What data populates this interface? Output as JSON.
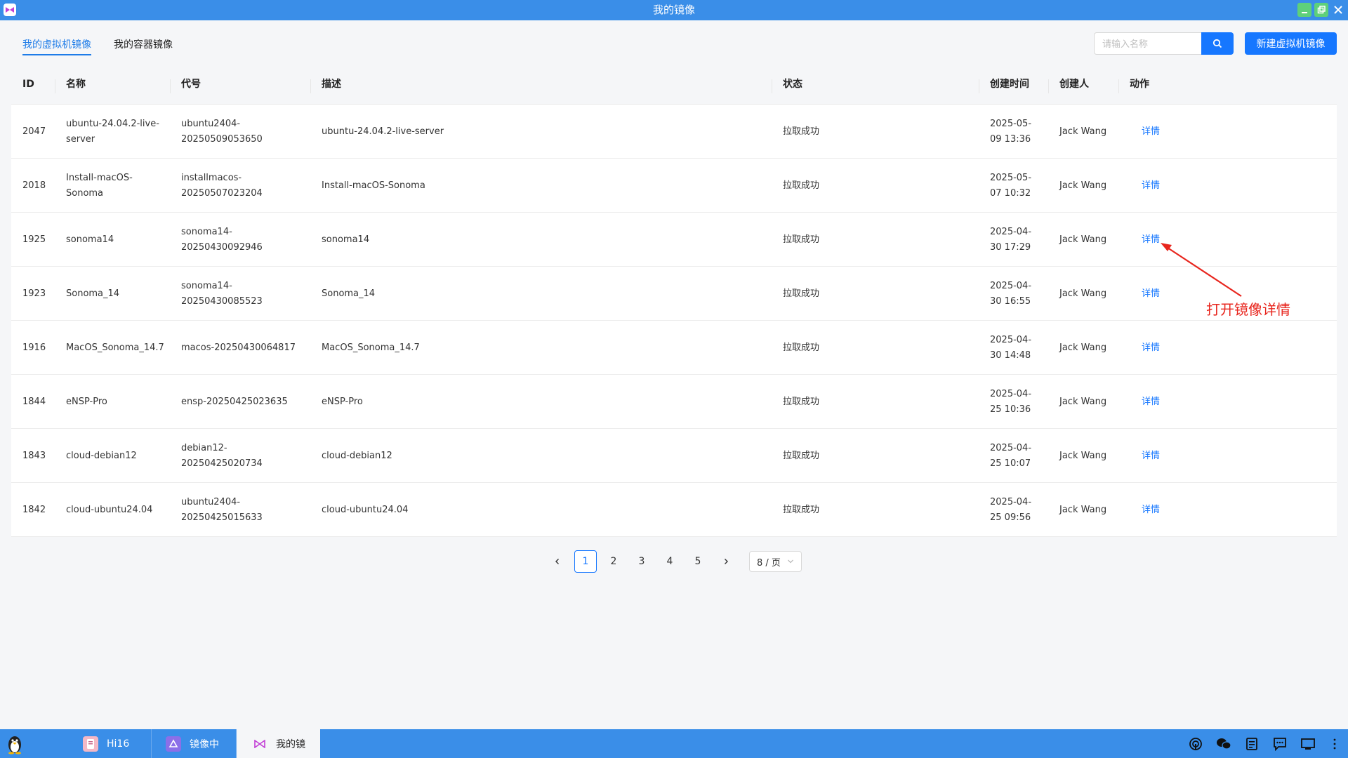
{
  "window": {
    "title": "我的镜像"
  },
  "tabs": [
    {
      "label": "我的虚拟机镜像",
      "active": true
    },
    {
      "label": "我的容器镜像",
      "active": false
    }
  ],
  "search": {
    "placeholder": "请输入名称",
    "value": ""
  },
  "new_button_label": "新建虚拟机镜像",
  "table": {
    "headers": [
      "ID",
      "名称",
      "代号",
      "描述",
      "状态",
      "创建时间",
      "创建人",
      "动作"
    ],
    "rows": [
      {
        "id": "2047",
        "name_lines": [
          "ubuntu-24.04.2-live-",
          "server"
        ],
        "code_lines": [
          "ubuntu2404-",
          "20250509053650"
        ],
        "desc": "ubuntu-24.04.2-live-server",
        "status": "拉取成功",
        "time_lines": [
          "2025-05-",
          "09 13:36"
        ],
        "creator": "Jack Wang",
        "action": "详情"
      },
      {
        "id": "2018",
        "name_lines": [
          "Install-macOS-",
          "Sonoma"
        ],
        "code_lines": [
          "installmacos-",
          "20250507023204"
        ],
        "desc": "Install-macOS-Sonoma",
        "status": "拉取成功",
        "time_lines": [
          "2025-05-",
          "07 10:32"
        ],
        "creator": "Jack Wang",
        "action": "详情"
      },
      {
        "id": "1925",
        "name_lines": [
          "sonoma14",
          ""
        ],
        "code_lines": [
          "sonoma14-",
          "20250430092946"
        ],
        "desc": "sonoma14",
        "status": "拉取成功",
        "time_lines": [
          "2025-04-",
          "30 17:29"
        ],
        "creator": "Jack Wang",
        "action": "详情"
      },
      {
        "id": "1923",
        "name_lines": [
          "Sonoma_14",
          ""
        ],
        "code_lines": [
          "sonoma14-",
          "20250430085523"
        ],
        "desc": "Sonoma_14",
        "status": "拉取成功",
        "time_lines": [
          "2025-04-",
          "30 16:55"
        ],
        "creator": "Jack Wang",
        "action": "详情"
      },
      {
        "id": "1916",
        "name_lines": [
          "MacOS_Sonoma_14.7",
          ""
        ],
        "code_lines": [
          "macos-20250430064817",
          ""
        ],
        "desc": "MacOS_Sonoma_14.7",
        "status": "拉取成功",
        "time_lines": [
          "2025-04-",
          "30 14:48"
        ],
        "creator": "Jack Wang",
        "action": "详情"
      },
      {
        "id": "1844",
        "name_lines": [
          "eNSP-Pro",
          ""
        ],
        "code_lines": [
          "ensp-20250425023635",
          ""
        ],
        "desc": "eNSP-Pro",
        "status": "拉取成功",
        "time_lines": [
          "2025-04-",
          "25 10:36"
        ],
        "creator": "Jack Wang",
        "action": "详情"
      },
      {
        "id": "1843",
        "name_lines": [
          "cloud-debian12",
          ""
        ],
        "code_lines": [
          "debian12-",
          "20250425020734"
        ],
        "desc": "cloud-debian12",
        "status": "拉取成功",
        "time_lines": [
          "2025-04-",
          "25 10:07"
        ],
        "creator": "Jack Wang",
        "action": "详情"
      },
      {
        "id": "1842",
        "name_lines": [
          "cloud-ubuntu24.04",
          ""
        ],
        "code_lines": [
          "ubuntu2404-",
          "20250425015633"
        ],
        "desc": "cloud-ubuntu24.04",
        "status": "拉取成功",
        "time_lines": [
          "2025-04-",
          "25 09:56"
        ],
        "creator": "Jack Wang",
        "action": "详情"
      }
    ]
  },
  "pagination": {
    "pages": [
      "1",
      "2",
      "3",
      "4",
      "5"
    ],
    "current": "1",
    "page_size_label": "8 / 页"
  },
  "annotation": {
    "text": "打开镜像详情",
    "color": "#e8251d"
  },
  "taskbar": {
    "items": [
      {
        "label": "Hi16",
        "active": false,
        "icon": "hi16-app-icon"
      },
      {
        "label": "镜像中",
        "active": false,
        "icon": "image-center-app-icon"
      },
      {
        "label": "我的镜",
        "active": true,
        "icon": "my-images-app-icon"
      }
    ],
    "tray_icons": [
      "hotspot-icon",
      "wechat-icon",
      "clipboard-icon",
      "chat-icon",
      "display-icon",
      "more-icon"
    ]
  },
  "colors": {
    "accent": "#1677ff",
    "titlebar": "#3a8ee8",
    "annotation": "#e8251d"
  }
}
